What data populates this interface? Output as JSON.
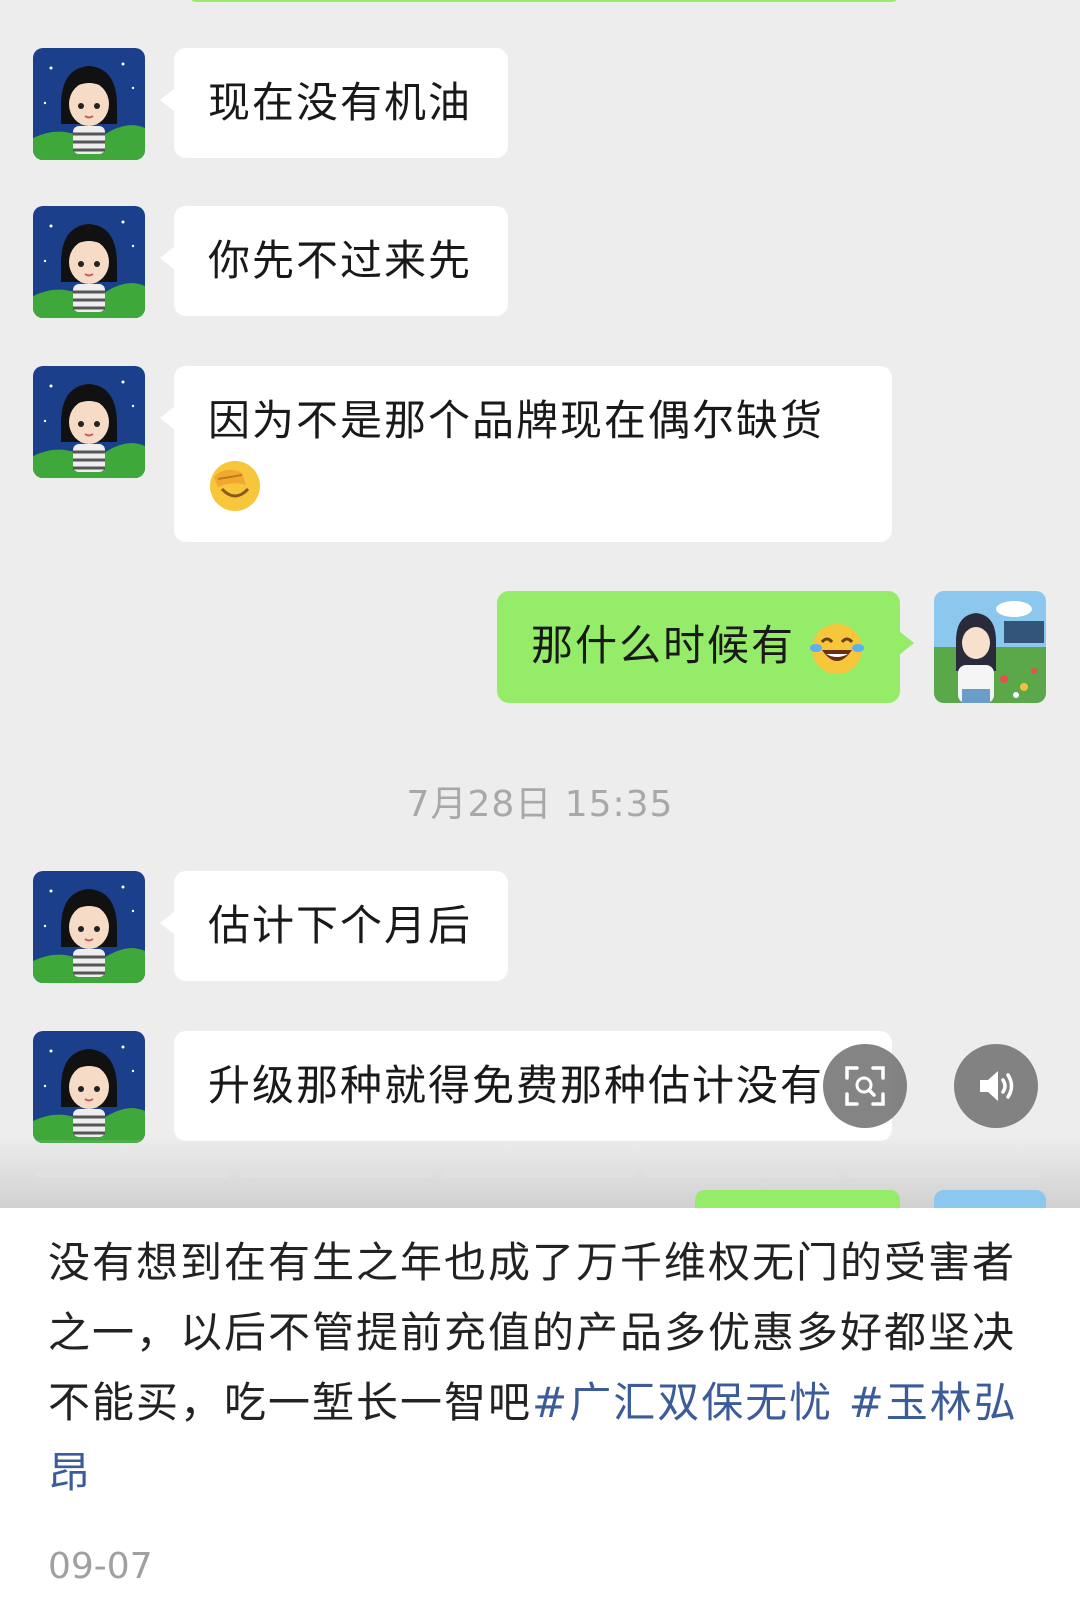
{
  "chat": {
    "messages": [
      {
        "side": "left",
        "text": "现在没有机油"
      },
      {
        "side": "left",
        "text": "你先不过来先"
      },
      {
        "side": "left",
        "text": "因为不是那个品牌现在偶尔缺货",
        "emoji": "facepalm-emoji"
      },
      {
        "side": "right",
        "text": "那什么时候有",
        "emoji": "tears-of-joy-emoji"
      },
      {
        "side": "left",
        "text": "估计下个月后"
      },
      {
        "side": "left",
        "text": "升级那种就得免费那种估计没有"
      }
    ],
    "timestamp": "7月28日 15:35"
  },
  "overlay": {
    "scan_icon": "scan-image-icon",
    "speaker_icon": "speaker-icon",
    "carousel_segments": 5
  },
  "post": {
    "text": "没有想到在有生之年也成了万千维权无门的受害者之一，以后不管提前充值的产品多优惠多好都坚决不能买，吃一堑长一智吧",
    "tag1": "#广汇双保无忧",
    "tag2": "#玉林弘昂",
    "date": "09-07"
  },
  "colors": {
    "chat_bg": "#ededed",
    "sent_bubble": "#95ec69",
    "received_bubble": "#ffffff",
    "hashtag": "#3b5c98"
  }
}
